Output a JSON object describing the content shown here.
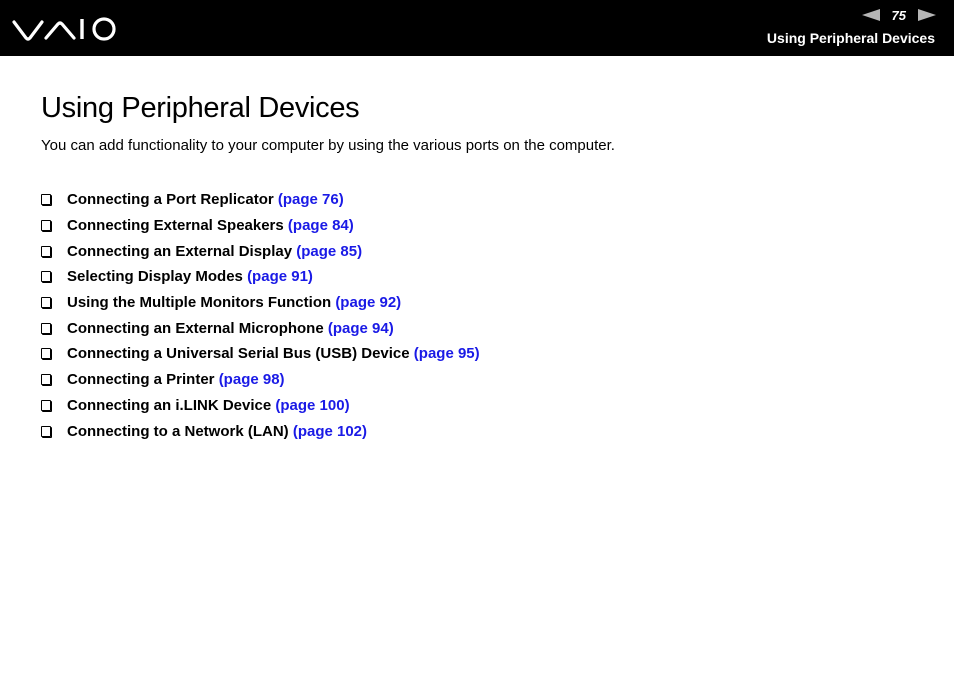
{
  "header": {
    "logo": "VAIO",
    "page_number": "75",
    "section_title": "Using Peripheral Devices",
    "prev_icon": "left-arrow-icon",
    "next_icon": "right-arrow-icon"
  },
  "main": {
    "title": "Using Peripheral Devices",
    "intro": "You can add functionality to your computer by using the various ports on the computer.",
    "items": [
      {
        "text": "Connecting a Port Replicator ",
        "link": "(page 76)"
      },
      {
        "text": "Connecting External Speakers ",
        "link": "(page 84)"
      },
      {
        "text": "Connecting an External Display ",
        "link": "(page 85)"
      },
      {
        "text": "Selecting Display Modes ",
        "link": "(page 91)"
      },
      {
        "text": "Using the Multiple Monitors Function ",
        "link": "(page 92)"
      },
      {
        "text": "Connecting an External Microphone ",
        "link": "(page 94)"
      },
      {
        "text": "Connecting a Universal Serial Bus (USB) Device ",
        "link": "(page 95)"
      },
      {
        "text": "Connecting a Printer ",
        "link": "(page 98)"
      },
      {
        "text": "Connecting an i.LINK Device ",
        "link": "(page 100)"
      },
      {
        "text": "Connecting to a Network (LAN) ",
        "link": "(page 102)"
      }
    ]
  },
  "colors": {
    "link": "#1a1ae6",
    "header_bg": "#000000",
    "arrow": "#b5b5b5"
  }
}
